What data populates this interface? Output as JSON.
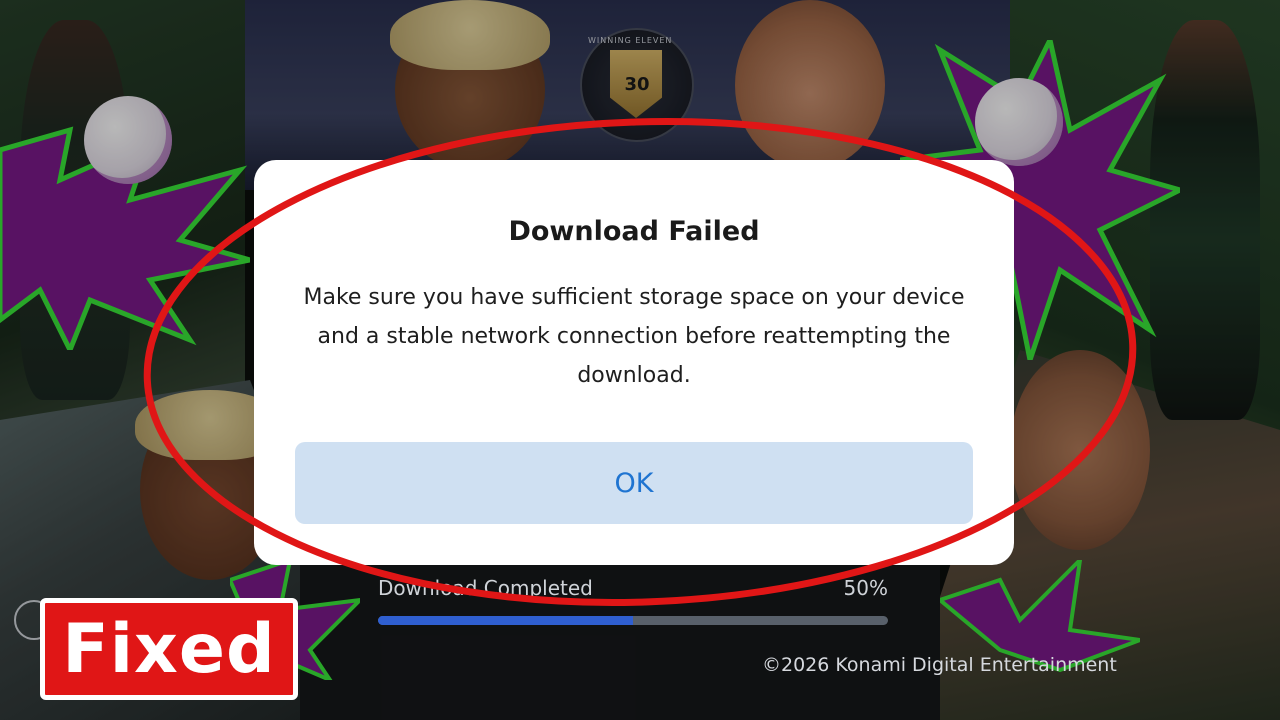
{
  "dialog": {
    "title": "Download Failed",
    "message": "Make sure you have sufficient storage space on your device and a stable network connection before reattempting the download.",
    "ok_label": "OK"
  },
  "download": {
    "status_text": "Download Completed",
    "percent_text": "50%",
    "progress_fraction": 0.5
  },
  "footer": {
    "copyright": "©2026 Konami Digital Entertainment"
  },
  "overlay": {
    "fixed_label": "Fixed"
  },
  "logo": {
    "number": "30",
    "ring_text": "WINNING ELEVEN"
  },
  "colors": {
    "accent_blue": "#1f74d1",
    "button_bg": "#cfe0f2",
    "highlight_red": "#e01616"
  }
}
